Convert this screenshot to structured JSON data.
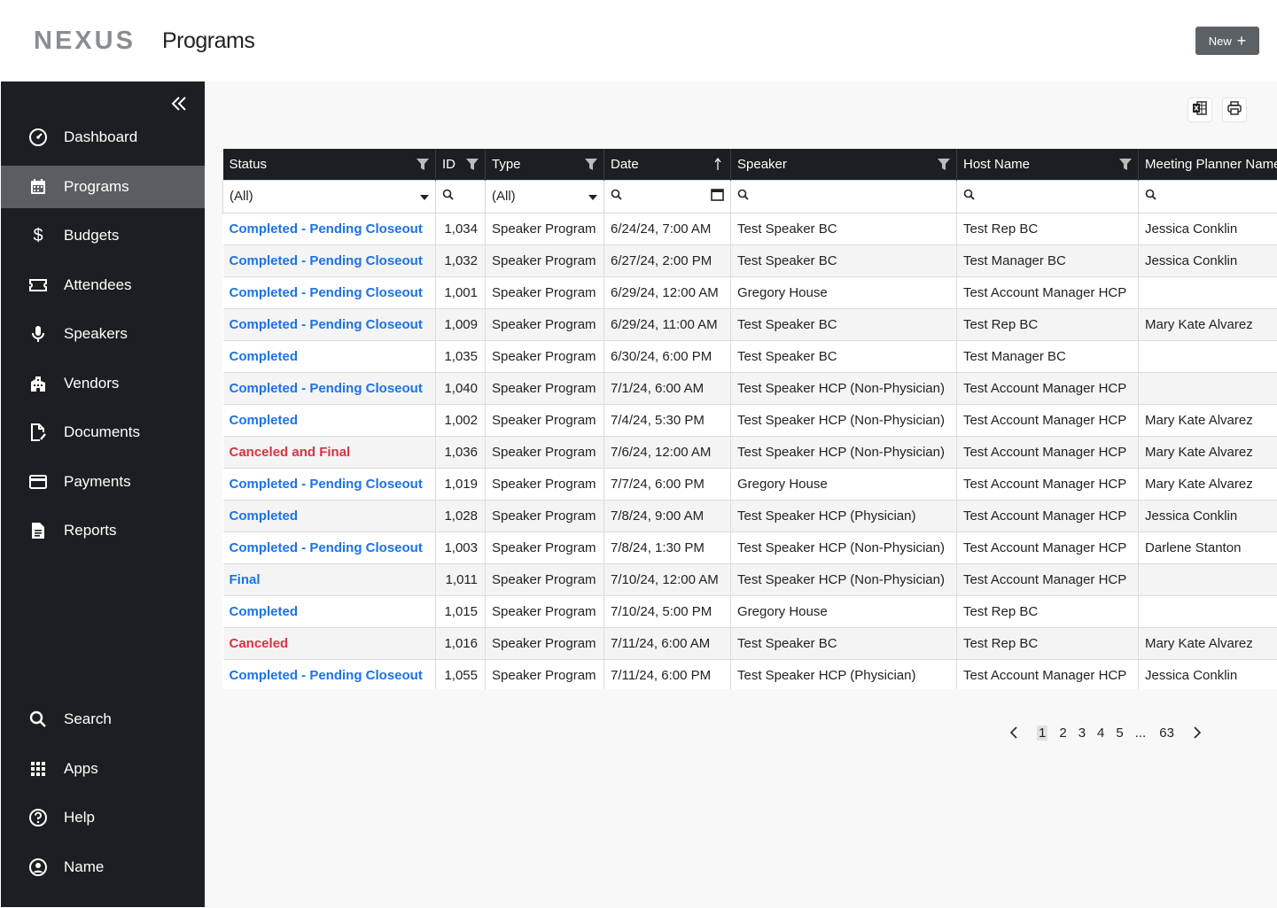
{
  "header": {
    "logo": "NEXUS",
    "title": "Programs",
    "new_label": "New"
  },
  "sidebar": {
    "top_items": [
      {
        "label": "Dashboard",
        "icon": "dashboard-icon",
        "active": false
      },
      {
        "label": "Programs",
        "icon": "calendar-icon",
        "active": true
      },
      {
        "label": "Budgets",
        "icon": "dollar-icon",
        "active": false
      },
      {
        "label": "Attendees",
        "icon": "ticket-icon",
        "active": false
      },
      {
        "label": "Speakers",
        "icon": "microphone-icon",
        "active": false
      },
      {
        "label": "Vendors",
        "icon": "building-icon",
        "active": false
      },
      {
        "label": "Documents",
        "icon": "document-edit-icon",
        "active": false
      },
      {
        "label": "Payments",
        "icon": "credit-card-icon",
        "active": false
      },
      {
        "label": "Reports",
        "icon": "report-icon",
        "active": false
      }
    ],
    "bottom_items": [
      {
        "label": "Search",
        "icon": "search-icon"
      },
      {
        "label": "Apps",
        "icon": "apps-grid-icon"
      },
      {
        "label": "Help",
        "icon": "help-icon"
      },
      {
        "label": "Name",
        "icon": "user-avatar-icon"
      }
    ]
  },
  "grid": {
    "columns": [
      "Status",
      "ID",
      "Type",
      "Date",
      "Speaker",
      "Host Name",
      "Meeting Planner Name"
    ],
    "filters": {
      "status": "(All)",
      "type": "(All)"
    },
    "rows": [
      {
        "status": "Completed - Pending Closeout",
        "status_color": "blue",
        "id": "1,034",
        "type": "Speaker Program",
        "date": "6/24/24, 7:00 AM",
        "speaker": "Test Speaker BC",
        "host": "Test Rep BC",
        "planner": "Jessica Conklin"
      },
      {
        "status": "Completed - Pending Closeout",
        "status_color": "blue",
        "id": "1,032",
        "type": "Speaker Program",
        "date": "6/27/24, 2:00 PM",
        "speaker": "Test Speaker BC",
        "host": "Test Manager BC",
        "planner": "Jessica Conklin"
      },
      {
        "status": "Completed - Pending Closeout",
        "status_color": "blue",
        "id": "1,001",
        "type": "Speaker Program",
        "date": "6/29/24, 12:00 AM",
        "speaker": "Gregory House",
        "host": "Test Account Manager HCP",
        "planner": ""
      },
      {
        "status": "Completed - Pending Closeout",
        "status_color": "blue",
        "id": "1,009",
        "type": "Speaker Program",
        "date": "6/29/24, 11:00 AM",
        "speaker": "Test Speaker BC",
        "host": "Test Rep BC",
        "planner": "Mary Kate Alvarez"
      },
      {
        "status": "Completed",
        "status_color": "blue",
        "id": "1,035",
        "type": "Speaker Program",
        "date": "6/30/24, 6:00 PM",
        "speaker": "Test Speaker BC",
        "host": "Test Manager BC",
        "planner": ""
      },
      {
        "status": "Completed - Pending Closeout",
        "status_color": "blue",
        "id": "1,040",
        "type": "Speaker Program",
        "date": "7/1/24, 6:00 AM",
        "speaker": "Test Speaker HCP (Non-Physician)",
        "host": "Test Account Manager HCP",
        "planner": ""
      },
      {
        "status": "Completed",
        "status_color": "blue",
        "id": "1,002",
        "type": "Speaker Program",
        "date": "7/4/24, 5:30 PM",
        "speaker": "Test Speaker HCP (Non-Physician)",
        "host": "Test Account Manager HCP",
        "planner": "Mary Kate Alvarez"
      },
      {
        "status": "Canceled and Final",
        "status_color": "red",
        "id": "1,036",
        "type": "Speaker Program",
        "date": "7/6/24, 12:00 AM",
        "speaker": "Test Speaker HCP (Non-Physician)",
        "host": "Test Account Manager HCP",
        "planner": "Mary Kate Alvarez"
      },
      {
        "status": "Completed - Pending Closeout",
        "status_color": "blue",
        "id": "1,019",
        "type": "Speaker Program",
        "date": "7/7/24, 6:00 PM",
        "speaker": "Gregory House",
        "host": "Test Account Manager HCP",
        "planner": "Mary Kate Alvarez"
      },
      {
        "status": "Completed",
        "status_color": "blue",
        "id": "1,028",
        "type": "Speaker Program",
        "date": "7/8/24, 9:00 AM",
        "speaker": "Test Speaker HCP (Physician)",
        "host": "Test Account Manager HCP",
        "planner": "Jessica Conklin"
      },
      {
        "status": "Completed - Pending Closeout",
        "status_color": "blue",
        "id": "1,003",
        "type": "Speaker Program",
        "date": "7/8/24, 1:30 PM",
        "speaker": "Test Speaker HCP (Non-Physician)",
        "host": "Test Account Manager HCP",
        "planner": "Darlene Stanton"
      },
      {
        "status": "Final",
        "status_color": "blue",
        "id": "1,011",
        "type": "Speaker Program",
        "date": "7/10/24, 12:00 AM",
        "speaker": "Test Speaker HCP (Non-Physician)",
        "host": "Test Account Manager HCP",
        "planner": ""
      },
      {
        "status": "Completed",
        "status_color": "blue",
        "id": "1,015",
        "type": "Speaker Program",
        "date": "7/10/24, 5:00 PM",
        "speaker": "Gregory House",
        "host": "Test Rep BC",
        "planner": ""
      },
      {
        "status": "Canceled",
        "status_color": "red",
        "id": "1,016",
        "type": "Speaker Program",
        "date": "7/11/24, 6:00 AM",
        "speaker": "Test Speaker BC",
        "host": "Test Rep BC",
        "planner": "Mary Kate Alvarez"
      },
      {
        "status": "Completed - Pending Closeout",
        "status_color": "blue",
        "id": "1,055",
        "type": "Speaker Program",
        "date": "7/11/24, 6:00 PM",
        "speaker": "Test Speaker HCP (Physician)",
        "host": "Test Account Manager HCP",
        "planner": "Jessica Conklin"
      }
    ]
  },
  "pager": {
    "pages": [
      "1",
      "2",
      "3",
      "4",
      "5"
    ],
    "ellipsis": "...",
    "last": "63",
    "current": "1"
  },
  "colors": {
    "sidebar": "#1b1e22",
    "active": "#5a5e63",
    "link_blue": "#1a73e8",
    "status_red": "#d93244"
  }
}
